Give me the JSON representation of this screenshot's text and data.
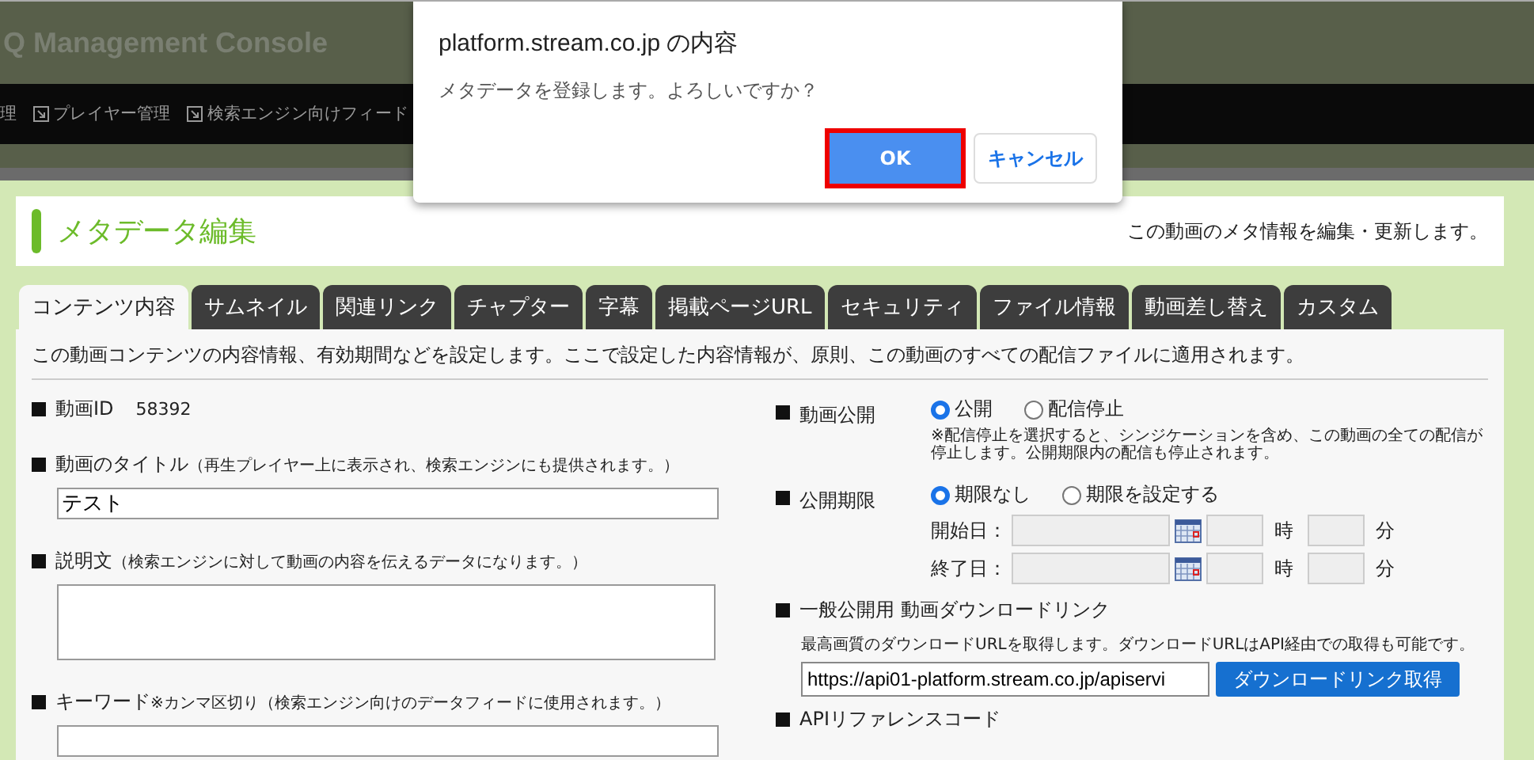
{
  "header": {
    "title": "Q Management Console"
  },
  "nav": {
    "items": [
      {
        "label": "理",
        "has_icon": false
      },
      {
        "label": "プレイヤー管理",
        "has_icon": true
      },
      {
        "label": "検索エンジン向けフィード",
        "has_icon": true
      }
    ]
  },
  "dialog": {
    "title": "platform.stream.co.jp の内容",
    "message": "メタデータを登録します。よろしいですか？",
    "buttons": [
      {
        "label": "OK",
        "kind": "primary",
        "highlighted": true
      },
      {
        "label": "キャンセル",
        "kind": "secondary",
        "highlighted": false
      }
    ]
  },
  "page": {
    "title": "メタデータ編集",
    "description": "この動画のメタ情報を編集・更新します。"
  },
  "tabs": [
    {
      "label": "コンテンツ内容",
      "selected": true
    },
    {
      "label": "サムネイル",
      "selected": false
    },
    {
      "label": "関連リンク",
      "selected": false
    },
    {
      "label": "チャプター",
      "selected": false
    },
    {
      "label": "字幕",
      "selected": false
    },
    {
      "label": "掲載ページURL",
      "selected": false
    },
    {
      "label": "セキュリティ",
      "selected": false
    },
    {
      "label": "ファイル情報",
      "selected": false
    },
    {
      "label": "動画差し替え",
      "selected": false
    },
    {
      "label": "カスタム",
      "selected": false
    }
  ],
  "intro": "この動画コンテンツの内容情報、有効期間などを設定します。ここで設定した内容情報が、原則、この動画のすべての配信ファイルに適用されます。",
  "left": {
    "video_id": {
      "label": "動画ID",
      "value": "58392"
    },
    "title_field": {
      "label": "動画のタイトル",
      "note": "（再生プレイヤー上に表示され、検索エンジンにも提供されます。）",
      "value": "テスト"
    },
    "description_field": {
      "label": "説明文",
      "note": "（検索エンジンに対して動画の内容を伝えるデータになります。）"
    },
    "keywords_field": {
      "label": "キーワード",
      "note": "※カンマ区切り（検索エンジン向けのデータフィードに使用されます。）"
    }
  },
  "right": {
    "publish": {
      "label": "動画公開",
      "options": [
        {
          "label": "公開",
          "selected": true
        },
        {
          "label": "配信停止",
          "selected": false
        }
      ],
      "note": "※配信停止を選択すると、シンジケーションを含め、この動画の全ての配信が停止します。公開期限内の配信も停止されます。"
    },
    "period": {
      "label": "公開期限",
      "options": [
        {
          "label": "期限なし",
          "selected": true
        },
        {
          "label": "期限を設定する",
          "selected": false
        }
      ],
      "rows": [
        {
          "label": "開始日：",
          "hour_unit": "時",
          "minute_unit": "分",
          "disabled": true
        },
        {
          "label": "終了日：",
          "hour_unit": "時",
          "minute_unit": "分",
          "disabled": true
        }
      ]
    },
    "download": {
      "label": "一般公開用 動画ダウンロードリンク",
      "note": "最高画質のダウンロードURLを取得します。ダウンロードURLはAPI経由での取得も可能です。",
      "url": "https://api01-platform.stream.co.jp/apiservi",
      "button": "ダウンロードリンク取得"
    },
    "api": {
      "label": "APIリファレンスコード"
    }
  }
}
